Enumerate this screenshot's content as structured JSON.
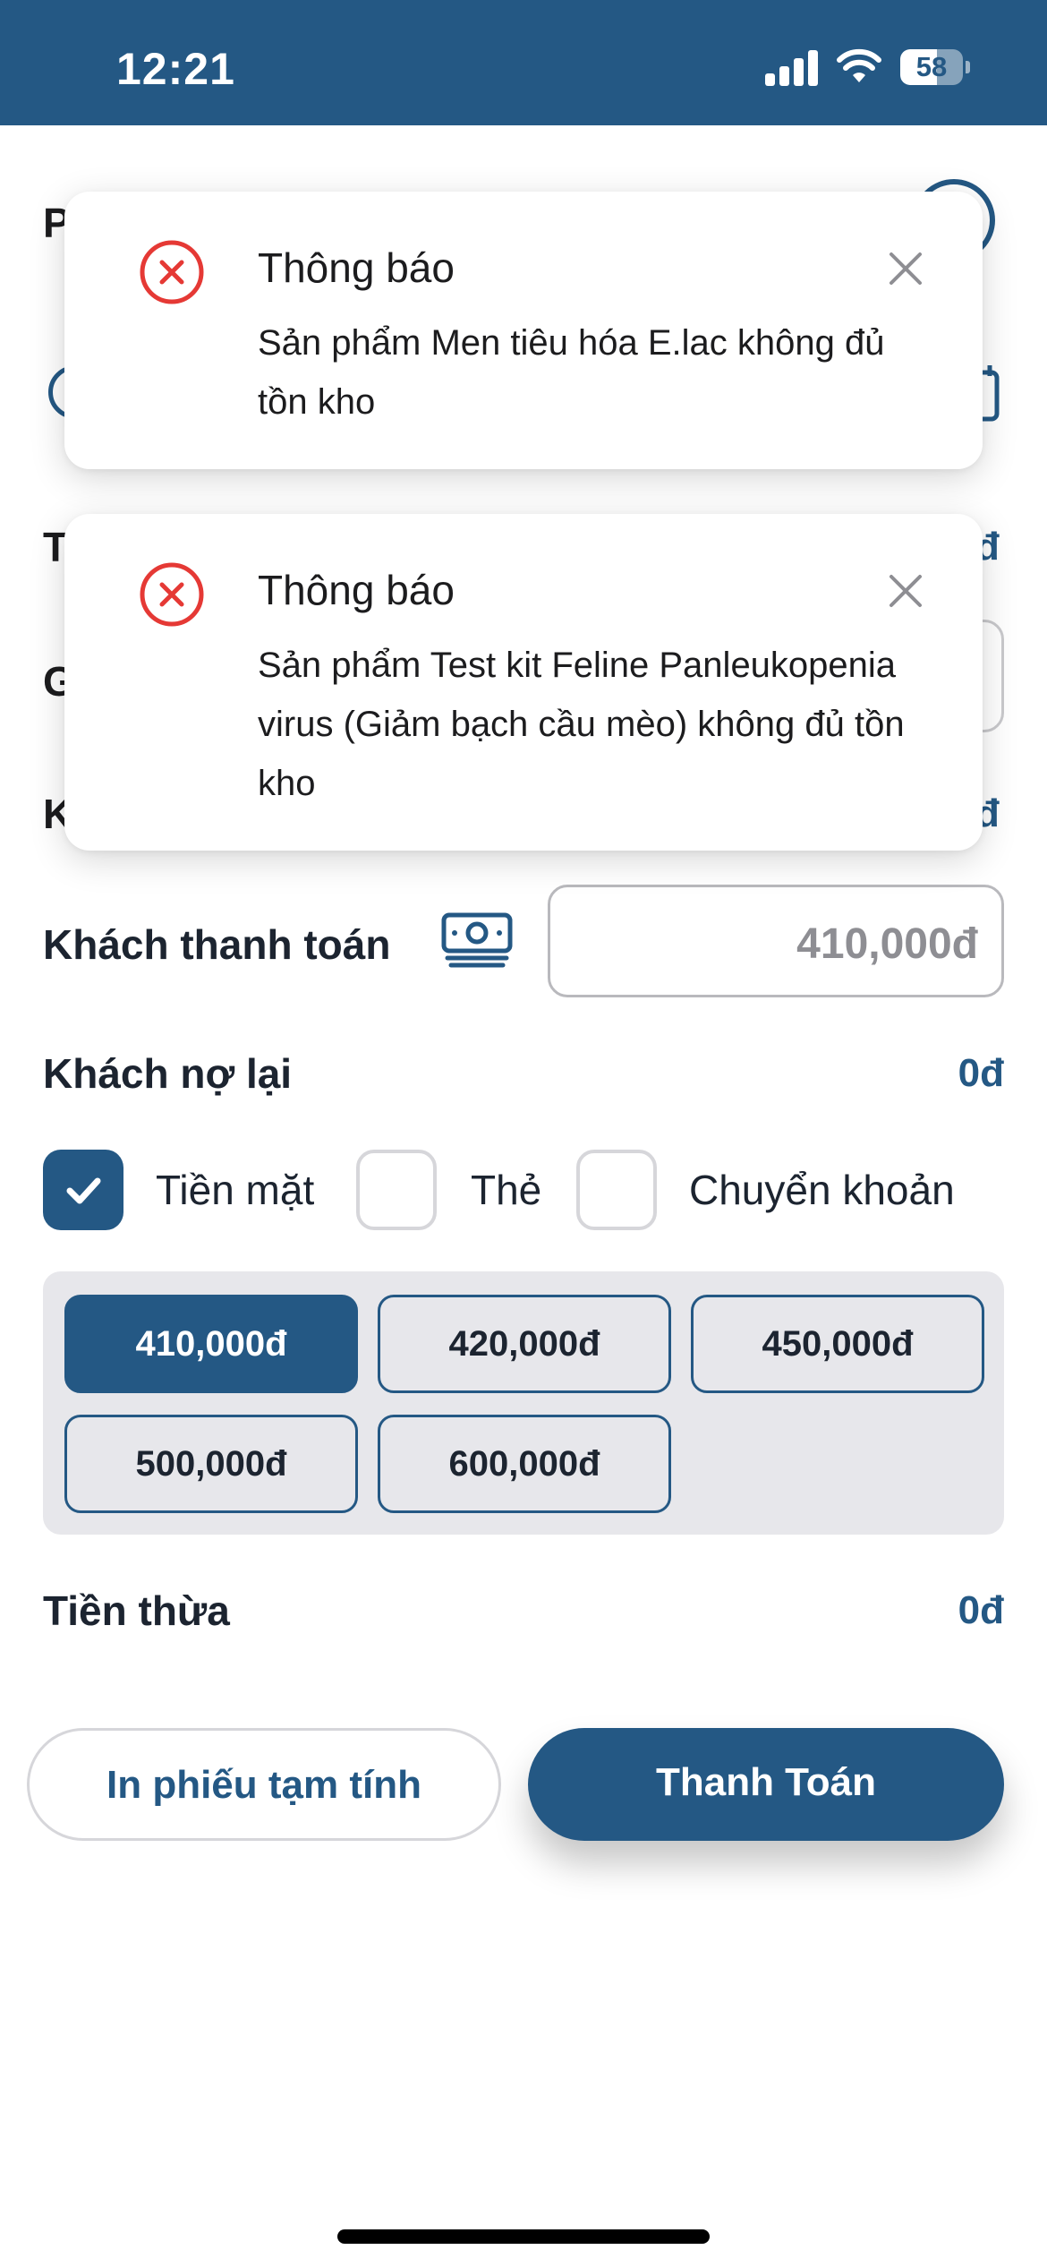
{
  "status_bar": {
    "time": "12:21",
    "battery": "58",
    "battery_level": 0.58
  },
  "background_fragments": {
    "row1_letter": "P",
    "row3_letter": "T",
    "row3_suffix": "đ",
    "row4_letter": "G",
    "row5_letter": "K",
    "row5_suffix": "đ"
  },
  "payment": {
    "customer_pays_label": "Khách thanh toán",
    "customer_pays_value": "410,000đ",
    "customer_owes_label": "Khách nợ lại",
    "customer_owes_value": "0đ",
    "methods": [
      {
        "label": "Tiền mặt",
        "checked": true
      },
      {
        "label": "Thẻ",
        "checked": false
      },
      {
        "label": "Chuyển khoản",
        "checked": false
      }
    ],
    "quick_amounts": [
      "410,000đ",
      "420,000đ",
      "450,000đ",
      "500,000đ",
      "600,000đ"
    ],
    "selected_amount_index": 0,
    "change_label": "Tiền thừa",
    "change_value": "0đ"
  },
  "actions": {
    "print_label": "In phiếu tạm tính",
    "pay_label": "Thanh Toán"
  },
  "toasts": [
    {
      "title": "Thông báo",
      "message": "Sản phẩm Men tiêu hóa E.lac không đủ tồn kho",
      "icon": "error-circle-icon"
    },
    {
      "title": "Thông báo",
      "message": "Sản phẩm Test kit Feline Panleukopenia virus (Giảm bạch cầu mèo) không đủ tồn kho",
      "icon": "error-circle-icon"
    }
  ],
  "colors": {
    "primary": "#245884",
    "error": "#e53935",
    "panel": "#e7e7eb"
  }
}
